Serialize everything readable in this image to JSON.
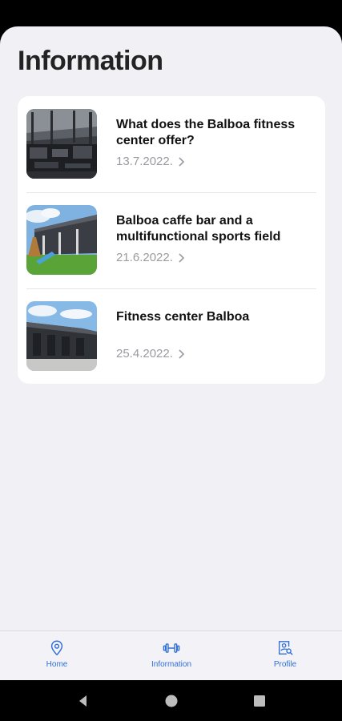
{
  "page": {
    "title": "Information"
  },
  "articles": [
    {
      "title": "What does the Balboa fitness center offer?",
      "date": "13.7.2022.",
      "image": "gym-interior-photo"
    },
    {
      "title": "Balboa caffe bar and a multifunctional sports field",
      "date": "21.6.2022.",
      "image": "cafe-bar-exterior-photo"
    },
    {
      "title": "Fitness center Balboa",
      "date": "25.4.2022.",
      "image": "fitness-building-photo"
    }
  ],
  "tabbar": {
    "home": {
      "label": "Home",
      "icon": "location-pin-icon"
    },
    "information": {
      "label": "Information",
      "icon": "dumbbell-icon"
    },
    "profile": {
      "label": "Profile",
      "icon": "profile-search-icon"
    }
  },
  "colors": {
    "accent": "#2f6fd6",
    "background": "#f0f0f5",
    "card": "#ffffff",
    "date": "#9a9aa0"
  },
  "system_nav": [
    "back-icon",
    "home-circle-icon",
    "recents-square-icon"
  ]
}
